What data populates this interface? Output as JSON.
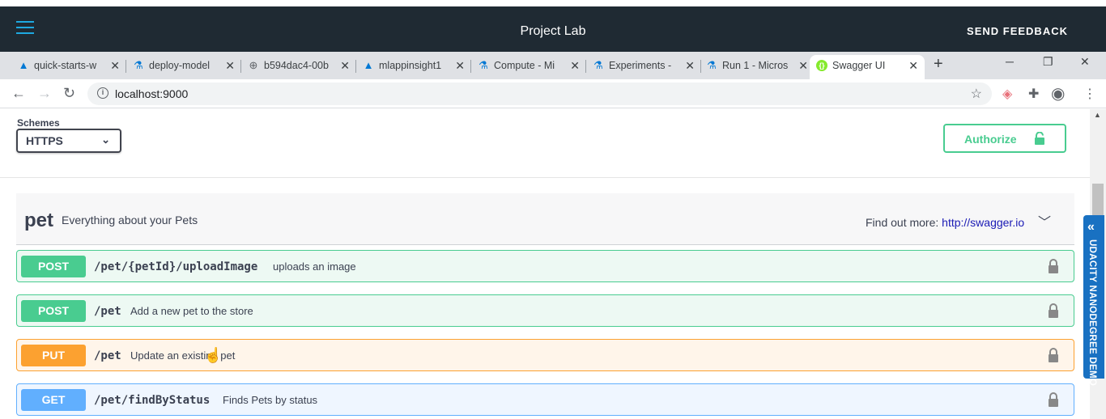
{
  "app": {
    "title": "Project Lab",
    "feedback_label": "SEND FEEDBACK"
  },
  "tabs": [
    {
      "label": "quick-starts-w",
      "icon": "azure-icon"
    },
    {
      "label": "deploy-model",
      "icon": "azure-ml-flask-icon"
    },
    {
      "label": "b594dac4-00b",
      "icon": "globe-icon"
    },
    {
      "label": "mlappinsight1",
      "icon": "azure-icon"
    },
    {
      "label": "Compute - Mi",
      "icon": "azure-ml-flask-icon"
    },
    {
      "label": "Experiments -",
      "icon": "azure-ml-flask-icon"
    },
    {
      "label": "Run 1 - Micros",
      "icon": "azure-ml-flask-icon"
    },
    {
      "label": "Swagger UI",
      "icon": "swagger-icon",
      "active": true
    }
  ],
  "address": {
    "url": "localhost:9000"
  },
  "swagger": {
    "schemes_label": "Schemes",
    "scheme_selected": "HTTPS",
    "authorize_label": "Authorize",
    "tag": {
      "name": "pet",
      "description": "Everything about your Pets",
      "find_more_label": "Find out more:",
      "find_more_link": "http://swagger.io"
    },
    "operations": [
      {
        "method": "POST",
        "path": "/pet/{petId}/uploadImage",
        "summary": "uploads an image"
      },
      {
        "method": "POST",
        "path": "/pet",
        "summary": "Add a new pet to the store"
      },
      {
        "method": "PUT",
        "path": "/pet",
        "summary": "Update an existing pet"
      },
      {
        "method": "GET",
        "path": "/pet/findByStatus",
        "summary": "Finds Pets by status"
      }
    ]
  },
  "sidetab": {
    "label": "UDACITY NANODEGREE DEMO"
  },
  "colors": {
    "post": "#49cc90",
    "put": "#fca130",
    "get": "#61affe",
    "appbar": "#1f2a33",
    "sidetab": "#1971c2"
  }
}
